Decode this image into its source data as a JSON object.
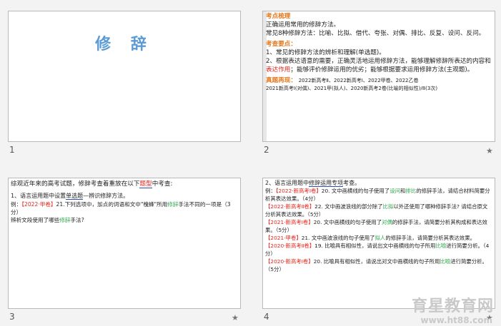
{
  "slides": [
    {
      "number": "1",
      "title": "修 辞"
    },
    {
      "number": "2",
      "sec1_title": "考点梳理",
      "l1": "正确运用常用的修辞方法。",
      "l2": "常见8种修辞方法：比喻、比拟、借代、夸张、对偶、排比、反复、设问、反问。",
      "sec2_title": "考查要点：",
      "l3": "1、常见的修辞方法的辨析和理解(单选题)。",
      "l4a": "2、根据表达语意的需要，正确灵活地运用修辞方法，能够理解修辞所表达的内容和",
      "l4b": "表达作用",
      "l4c": "；能够评价修辞运用的优劣；能够根据要求运用修辞方法(主观题)。",
      "sec3_title": "真题再现：",
      "l5": "2022新高考Ⅱ、2022新高考Ⅰ、2022甲卷、2022乙卷",
      "l6": "2021新高考Ⅰ(对偶)、2021甲(拟人)、2020新高考2卷(比喻的相似性)/8(3次)"
    },
    {
      "number": "3",
      "l1a": "综观近年来的高考试题，修辞考查着重放在以下",
      "l1b": "题型",
      "l1c": "中考查:",
      "l2a": "1、语言运用题中设置",
      "l2b": "单选题",
      "l2c": "—辨识修辞方法。",
      "l3a": "例：",
      "l3b": "【2022·甲卷】",
      "l3c": "21.下列选项中，加点的词语和文中\"槐蜂\"所用",
      "l3d": "修辞",
      "l3e": "手法不同的一项是（3分）",
      "l4a": "辨析文段使用了哪些",
      "l4b": "修辞",
      "l4c": "手法?"
    },
    {
      "number": "4",
      "h1a": "2、语言运用题中",
      "h1b": "修辞运用专项",
      "h1c": "考查。",
      "e1a": "例：",
      "e1b": "【2022·新高考Ⅰ卷】",
      "e1c": "20. 文中画横线的句子使用了",
      "e1d": "设问",
      "e1e": "和",
      "e1f": "排比",
      "e1g": "的修辞手法，请结合材料简要分析其表达效果。（4分）",
      "e2a": "【2022·新高考Ⅱ卷】",
      "e2b": "22. 文中画波浪线的部分除了",
      "e2c": "比拟",
      "e2d": "以外还使用了哪种修辞手法? 请结合原文分析其表达效果。（5分）",
      "e3a": "【2021·新高考Ⅰ卷】",
      "e3b": "20. 文中画横线的句子使用了",
      "e3c": "对偶",
      "e3d": "的修辞手法，请简要分析其构成和表达效果。（5分）",
      "e4a": "【2021·甲卷】",
      "e4b": "21. 文中画波浪线的句子使用了",
      "e4c": "拟人",
      "e4d": "的修辞手法，请简要分析其表达效果。",
      "e5a": "【2020·新高考Ⅱ卷】",
      "e5b": "19. 比喻具有相似性，请说出文中画横线的句子所用",
      "e5c": "比喻",
      "e5d": "进行简要分析。（4分）",
      "e6a": "【2020·新高考Ⅰ卷】",
      "e6b": "20. 比喻具有相似性，请说出对文中画横线的句子所用",
      "e6c": "比喻",
      "e6d": "进行简要分析。（5分）"
    }
  ],
  "star": "★",
  "watermark": {
    "text": "育星教育网",
    "url": "www.ht88.com"
  }
}
